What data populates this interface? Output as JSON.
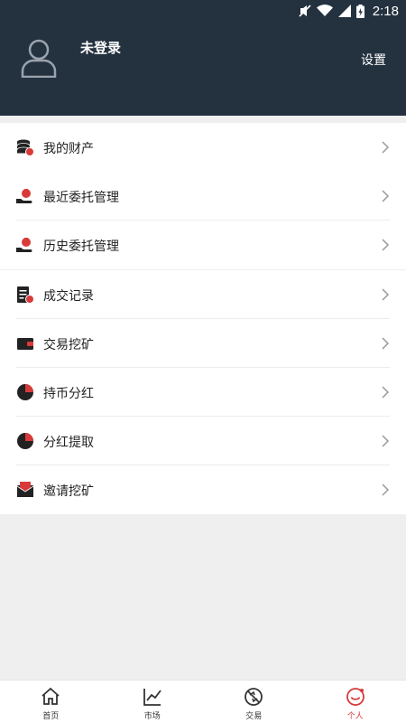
{
  "status": {
    "time": "2:18"
  },
  "header": {
    "login_status": "未登录",
    "settings_label": "设置"
  },
  "sections": [
    {
      "items": [
        {
          "label": "我的财产",
          "icon": "coins-stack-icon"
        }
      ]
    },
    {
      "items": [
        {
          "label": "最近委托管理",
          "icon": "hand-moneybag-icon"
        },
        {
          "label": "历史委托管理",
          "icon": "hand-moneybag-icon"
        }
      ]
    },
    {
      "items": [
        {
          "label": "成交记录",
          "icon": "record-doc-icon"
        },
        {
          "label": "交易挖矿",
          "icon": "wallet-icon"
        },
        {
          "label": "持币分红",
          "icon": "pie-chart-icon"
        },
        {
          "label": "分红提取",
          "icon": "pie-chart-icon"
        },
        {
          "label": "邀请挖矿",
          "icon": "envelope-icon"
        }
      ]
    }
  ],
  "tabbar": [
    {
      "label": "首页",
      "icon": "home-icon",
      "active": false
    },
    {
      "label": "市场",
      "icon": "line-chart-icon",
      "active": false
    },
    {
      "label": "交易",
      "icon": "trade-icon",
      "active": false
    },
    {
      "label": "个人",
      "icon": "profile-icon",
      "active": true
    }
  ],
  "colors": {
    "header_bg": "#24313f",
    "accent_red": "#d83a3a",
    "page_bg": "#efefef"
  }
}
